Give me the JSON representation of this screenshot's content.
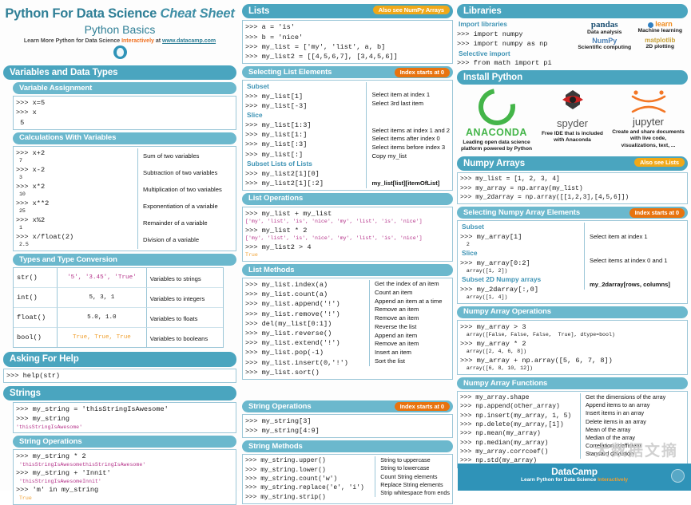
{
  "header": {
    "title_a": "Python For Data Science",
    "title_b": "Cheat Sheet",
    "subtitle": "Python Basics",
    "tagline_a": "Learn More Python for Data Science ",
    "tagline_b": "Interactively",
    "tagline_c": " at ",
    "tagline_link": "www.datacamp.com",
    "logo": "datacamp-logo-icon"
  },
  "left": {
    "variables_banner": "Variables and Data Types",
    "variable_assignment": {
      "banner": "Variable Assignment",
      "lines": [
        ">>> x=5",
        ">>> x",
        " 5"
      ]
    },
    "calculations": {
      "banner": "Calculations With Variables",
      "rows": [
        {
          "code": ">>> x+2",
          "out": " 7",
          "desc": "Sum of two variables"
        },
        {
          "code": ">>> x-2",
          "out": " 3",
          "desc": "Subtraction of two variables"
        },
        {
          "code": ">>> x*2",
          "out": " 10",
          "desc": "Multiplication of two variables"
        },
        {
          "code": ">>> x**2",
          "out": " 25",
          "desc": "Exponentiation of a variable"
        },
        {
          "code": ">>> x%2",
          "out": " 1",
          "desc": "Remainder of a variable"
        },
        {
          "code": ">>> x/float(2)",
          "out": " 2.5",
          "desc": "Division of a variable"
        }
      ]
    },
    "types": {
      "banner": "Types and Type Conversion",
      "rows": [
        {
          "fn": "str()",
          "val": "'5', '3.45', 'True'",
          "desc": "Variables to strings",
          "color": "#b5338a"
        },
        {
          "fn": "int()",
          "val": "5, 3, 1",
          "desc": "Variables to integers",
          "color": "#1a1a1a"
        },
        {
          "fn": "float()",
          "val": "5.0, 1.0",
          "desc": "Variables to floats",
          "color": "#1a1a1a"
        },
        {
          "fn": "bool()",
          "val": "True, True, True",
          "desc": "Variables to booleans",
          "color": "#f0a030"
        }
      ]
    },
    "help": {
      "banner": "Asking For Help",
      "line": ">>> help(str)"
    },
    "strings": {
      "banner": "Strings",
      "lines": [
        ">>> my_string = 'thisStringIsAwesome'",
        ">>> my_string"
      ],
      "out": "'thisStringIsAwesome'"
    },
    "string_ops": {
      "banner": "String Operations",
      "rows": [
        {
          "code": ">>> my_string * 2",
          "out": " 'thisStringIsAwesomethisStringIsAwesome'"
        },
        {
          "code": ">>> my_string + 'Innit'",
          "out": " 'thisStringIsAwesomeInnit'"
        },
        {
          "code": ">>> 'm' in my_string",
          "out": " True"
        }
      ]
    }
  },
  "mid": {
    "lists": {
      "banner": "Lists",
      "pill": "Also see NumPy Arrays",
      "lines": [
        ">>> a = 'is'",
        ">>> b = 'nice'",
        ">>> my_list = ['my', 'list', a, b]",
        ">>> my_list2 = [[4,5,6,7], [3,4,5,6]]"
      ]
    },
    "selecting": {
      "banner": "Selecting List Elements",
      "pill": "Index starts at 0",
      "groups": [
        {
          "head": "Subset",
          "items": [
            {
              "code": ">>> my_list[1]",
              "desc": "Select item at index 1"
            },
            {
              "code": ">>> my_list[-3]",
              "desc": "Select 3rd last item"
            }
          ]
        },
        {
          "head": "Slice",
          "items": [
            {
              "code": ">>> my_list[1:3]",
              "desc": "Select items at index 1 and 2"
            },
            {
              "code": ">>> my_list[1:]",
              "desc": "Select items after index 0"
            },
            {
              "code": ">>> my_list[:3]",
              "desc": "Select items before index 3"
            },
            {
              "code": ">>> my_list[:]",
              "desc": "Copy my_list"
            }
          ]
        },
        {
          "head": "Subset Lists of Lists",
          "items": [
            {
              "code": ">>> my_list2[1][0]",
              "desc": "my_list[list][itemOfList]"
            },
            {
              "code": ">>> my_list2[1][:2]",
              "desc": ""
            }
          ]
        }
      ]
    },
    "list_ops": {
      "banner": "List Operations",
      "rows": [
        {
          "code": ">>> my_list + my_list",
          "out": "['my', 'list', 'is', 'nice', 'my', 'list', 'is', 'nice']"
        },
        {
          "code": ">>> my_list * 2",
          "out": "['my', 'list', 'is', 'nice', 'my', 'list', 'is', 'nice']"
        },
        {
          "code": ">>> my_list2 > 4",
          "out": "True",
          "out_color": "#f0a030"
        }
      ]
    },
    "list_methods": {
      "banner": "List Methods",
      "rows": [
        {
          "code": ">>> my_list.index(a)",
          "desc": "Get the index of an item"
        },
        {
          "code": ">>> my_list.count(a)",
          "desc": "Count an item"
        },
        {
          "code": ">>> my_list.append('!')",
          "desc": "Append an item at a time"
        },
        {
          "code": ">>> my_list.remove('!')",
          "desc": "Remove an item"
        },
        {
          "code": ">>> del(my_list[0:1])",
          "desc": "Remove an item"
        },
        {
          "code": ">>> my_list.reverse()",
          "desc": "Reverse the list"
        },
        {
          "code": ">>> my_list.extend('!')",
          "desc": "Append an item"
        },
        {
          "code": ">>> my_list.pop(-1)",
          "desc": "Remove an item"
        },
        {
          "code": ">>> my_list.insert(0,'!')",
          "desc": "Insert an item"
        },
        {
          "code": ">>> my_list.sort()",
          "desc": "Sort the list"
        }
      ]
    },
    "string_operations": {
      "banner": "String Operations",
      "pill": "Index starts at 0",
      "lines": [
        ">>> my_string[3]",
        ">>> my_string[4:9]"
      ]
    },
    "string_methods": {
      "banner": "String Methods",
      "rows": [
        {
          "code": ">>> my_string.upper()",
          "desc": "String to uppercase"
        },
        {
          "code": ">>> my_string.lower()",
          "desc": "String to lowercase"
        },
        {
          "code": ">>> my_string.count('w')",
          "desc": "Count String elements"
        },
        {
          "code": ">>> my_string.replace('e', 'i')",
          "desc": "Replace String elements"
        },
        {
          "code": ">>> my_string.strip()",
          "desc": "Strip whitespace from ends"
        }
      ]
    }
  },
  "right": {
    "libraries": {
      "banner": "Libraries",
      "import_head": "Import libraries",
      "import_lines": [
        ">>> import numpy",
        ">>> import numpy as np"
      ],
      "selective_head": "Selective import",
      "selective_lines": [
        ">>> from math import pi"
      ],
      "logos": [
        {
          "name": "pandas",
          "caption": "Data analysis",
          "icon": "pandas-logo-icon"
        },
        {
          "name": "learn",
          "caption": "Machine learning",
          "icon": "scikit-learn-logo-icon"
        },
        {
          "name": "NumPy",
          "caption": "Scientific computing",
          "icon": "numpy-logo-icon"
        },
        {
          "name": "matplotlib",
          "caption": "2D plotting",
          "icon": "matplotlib-logo-icon"
        }
      ]
    },
    "install": {
      "banner": "Install Python",
      "items": [
        {
          "name": "ANACONDA",
          "caption": "Leading open data science platform powered by Python",
          "icon": "anaconda-logo-icon"
        },
        {
          "name": "spyder",
          "caption": "Free IDE that is included with Anaconda",
          "icon": "spyder-logo-icon"
        },
        {
          "name": "jupyter",
          "caption": "Create and share documents with live code, visualizations, text, ...",
          "icon": "jupyter-logo-icon"
        }
      ]
    },
    "numpy_arrays": {
      "banner": "Numpy Arrays",
      "pill": "Also see Lists",
      "lines": [
        ">>> my_list = [1, 2, 3, 4]",
        ">>> my_array = np.array(my_list)",
        ">>> my_2darray = np.array([[1,2,3],[4,5,6]])"
      ]
    },
    "selecting_numpy": {
      "banner": "Selecting Numpy Array Elements",
      "pill": "Index starts at 0",
      "groups": [
        {
          "head": "Subset",
          "code": ">>> my_array[1]",
          "out": "  2",
          "desc": "Select item at index 1"
        },
        {
          "head": "Slice",
          "code": ">>> my_array[0:2]",
          "out": "  array([1, 2])",
          "desc": "Select items at index 0 and 1"
        },
        {
          "head": "Subset 2D Numpy arrays",
          "code": ">>> my_2darray[:,0]",
          "out": "  array([1, 4])",
          "desc": "my_2darray[rows, columns]"
        }
      ]
    },
    "numpy_ops": {
      "banner": "Numpy Array Operations",
      "rows": [
        {
          "code": ">>> my_array > 3",
          "out": "  array([False, False, False,  True], dtype=bool)"
        },
        {
          "code": ">>> my_array * 2",
          "out": "  array([2, 4, 6, 8])"
        },
        {
          "code": ">>> my_array + np.array([5, 6, 7, 8])",
          "out": "  array([6, 8, 10, 12])"
        }
      ]
    },
    "numpy_functions": {
      "banner": "Numpy Array Functions",
      "rows": [
        {
          "code": ">>> my_array.shape",
          "desc": "Get the dimensions of the array"
        },
        {
          "code": ">>> np.append(other_array)",
          "desc": "Append items to an array"
        },
        {
          "code": ">>> np.insert(my_array, 1, 5)",
          "desc": "Insert items in an array"
        },
        {
          "code": ">>> np.delete(my_array,[1])",
          "desc": "Delete items in an array"
        },
        {
          "code": ">>> np.mean(my_array)",
          "desc": "Mean of the array"
        },
        {
          "code": ">>> np.median(my_array)",
          "desc": "Median of the array"
        },
        {
          "code": ">>> my_array.corrcoef()",
          "desc": "Correlation coefficient"
        },
        {
          "code": ">>> np.std(my_array)",
          "desc": "Standard deviation"
        }
      ]
    }
  },
  "footer": {
    "brand": "DataCamp",
    "slogan_a": "Learn Python for Data Science ",
    "slogan_b": "Interactively",
    "badge": "datacamp-badge-icon",
    "watermark": "大数据文摘"
  }
}
